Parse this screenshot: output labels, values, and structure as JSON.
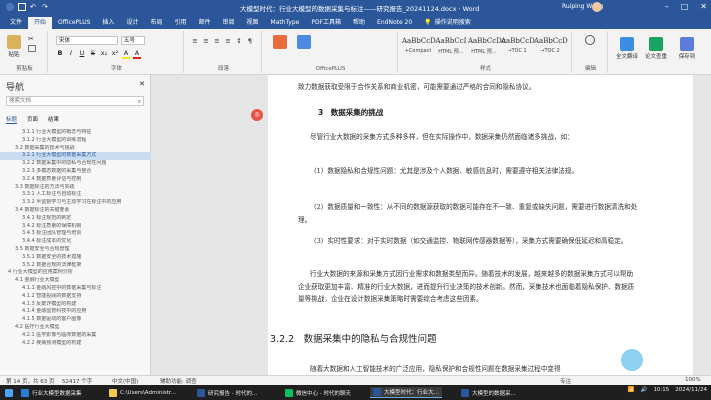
{
  "window": {
    "title": "大模型时代：行业大模型的数据采集与标注——研究报告_20241124.docx · Word",
    "user": "Ruiping Wang",
    "controls": [
      "–",
      "□",
      "✕"
    ]
  },
  "ribbon_tabs": [
    "文件",
    "开始",
    "OfficePLUS",
    "插入",
    "设计",
    "布局",
    "引用",
    "邮件",
    "审阅",
    "视图",
    "MathType",
    "PDF工具箱",
    "帮助",
    "EndNote 20"
  ],
  "active_tab_index": 1,
  "tell_me": "操作说明搜索",
  "ribbon": {
    "clipboard": {
      "paste": "粘贴",
      "cut": "✂",
      "label": "剪贴板"
    },
    "font": {
      "name": "宋体",
      "size": "五号",
      "label": "字体",
      "buttons": [
        "B",
        "I",
        "U",
        "S",
        "x₂",
        "x²",
        "A",
        "A"
      ]
    },
    "paragraph": {
      "label": "段落",
      "buttons": [
        "≡",
        "≡",
        "≡",
        "≡",
        "↕",
        "¶"
      ]
    },
    "officeplus": {
      "label": "OfficePLUS"
    },
    "styles": {
      "label": "样式",
      "items": [
        {
          "sample": "AaBbCcD",
          "name": "+Compact"
        },
        {
          "sample": "AaBbCcI",
          "name": "HTML 预…"
        },
        {
          "sample": "AaBbCcDc",
          "name": "HTML 预…"
        },
        {
          "sample": "AaBbCcD",
          "name": "→TOC 1"
        },
        {
          "sample": "AaBbCcD",
          "name": "→TOC 2"
        }
      ]
    },
    "editing": {
      "label": "编辑"
    },
    "extra": [
      "全文翻译",
      "论文查重",
      "保存到"
    ]
  },
  "navigation": {
    "title": "导航",
    "search_placeholder": "搜索文档",
    "tabs": [
      "标题",
      "页面",
      "结果"
    ],
    "items": [
      "3.1.1 行业大模型的概念与特征",
      "3.1.2 行业大模型的训练流程",
      "3.2 数据采集的技术与挑战",
      "3.2.1 行业大模型的数据采集方式",
      "3.2.2 数据采集中的隐私与合规性问题",
      "3.2.3 多模态数据的采集与整合",
      "3.2.4 数据质量评估与控制",
      "3.3 数据标注的方法与实践",
      "3.3.1 人工标注与自动标注",
      "3.3.2 半监督学习与主动学习在标注中的应用",
      "3.4 数据标注的关键要素",
      "3.4.1 标注规范的制定",
      "3.4.2 标注质量的保障机制",
      "3.4.3 标注团队管理与培训",
      "3.4.4 标注成本的优化",
      "3.5 数据安全与合规管理",
      "3.5.1 数据安全的技术措施",
      "3.5.2 数据合规的法律框架",
      "4 行业大模型的应用案例分析",
      "4.1 金融行业大模型",
      "4.1.1 金融风控中的数据采集与标注",
      "4.1.2 智能投顾的数据支持",
      "4.1.3 反欺诈模型的构建",
      "4.1.4 金融监管科技中的应用",
      "4.1.5 数据驱动的客户画像",
      "4.2 医疗行业大模型",
      "4.2.1 医学影像与临床数据的采集",
      "4.2.2 疾病预测模型的构建"
    ],
    "selected_index": 3
  },
  "document": {
    "intro": "致力数据获取受限于合作关系和商业机密，可能需要通过严格的合同和隐私协议。",
    "section_heading": "3　数据采集的挑战",
    "para1": "尽管行业大数据的采集方式多种多样，但在实际操作中，数据采集仍然面临诸多挑战，如：",
    "item1": "（1）数据隐私和合规性问题：尤其是涉及个人数据、敏感信息时，需要遵守相关法律法规。",
    "item2": "（2）数据质量和一致性：从不同的数据源获取的数据可能存在不一致、重复或缺失问题，需要进行数据清洗和处理。",
    "item3": "（3）实时性要求：对于实时数据（如交通监控、物联网传感器数据等），采集方式需要确保低延迟和高稳定。",
    "para2": "行业大数据的来源和采集方式因行业需求和数据类型而异。随着技术的发展，越来越多的数据采集方式可以帮助企业获取更加丰富、精准的行业大数据，进而提升行业决策的技术创新。然而，采集技术也面临着隐私保护、数据质量等挑战，企业在设计数据采集策略时需要综合考虑这些因素。",
    "subheading": "3.2.2　数据采集中的隐私与合规性问题",
    "para3": "随着大数据和人工智能技术的广泛应用，隐私保护和合规性问题在数据采集过程中变得"
  },
  "status": {
    "page": "第 14 页，共 63 页",
    "words": "52417 个字",
    "lang": "中文(中国)",
    "accessibility": "辅助功能: 调查",
    "focus": "专注",
    "zoom": "100%"
  },
  "taskbar": {
    "items": [
      {
        "label": "行业大模型数据采集",
        "active": false,
        "color": "#2b7cd3"
      },
      {
        "label": "C:\\Users\\Administr...",
        "active": false,
        "color": "#f2c94c"
      },
      {
        "label": "研究报告 - 时代的…",
        "active": false,
        "color": "#2b579a"
      },
      {
        "label": "微信中心 - 时代的聊天",
        "active": false,
        "color": "#07c160"
      },
      {
        "label": "大模型时代：行业大…",
        "active": true,
        "color": "#2b579a"
      },
      {
        "label": "大模型的数据采…",
        "active": false,
        "color": "#2b579a"
      }
    ],
    "time": "10:15",
    "date": "2024/11/24"
  }
}
